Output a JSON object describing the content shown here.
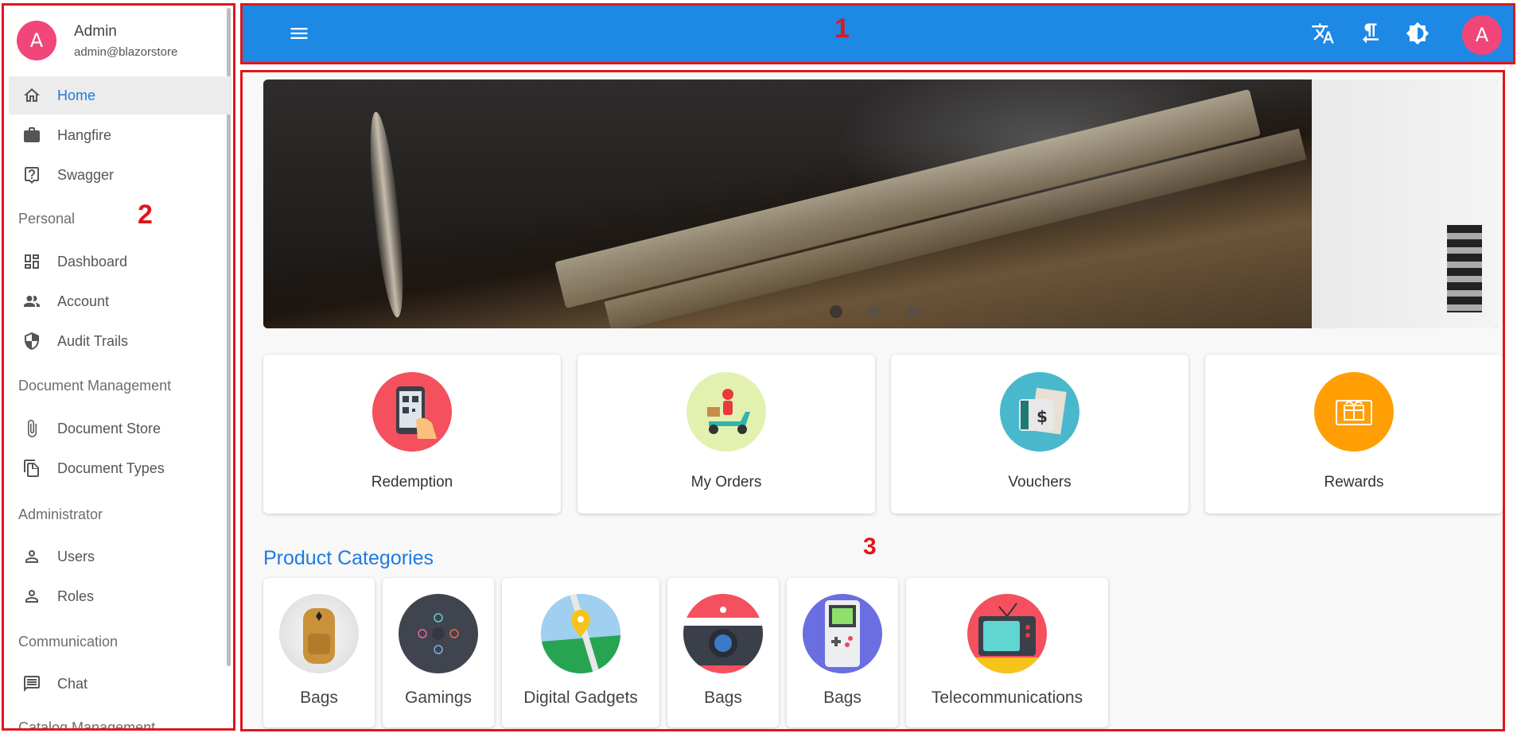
{
  "user": {
    "avatar_letter": "A",
    "name": "Admin",
    "email": "admin@blazorstore"
  },
  "nav": {
    "home": "Home",
    "hangfire": "Hangfire",
    "swagger": "Swagger",
    "section_personal": "Personal",
    "dashboard": "Dashboard",
    "account": "Account",
    "audit_trails": "Audit Trails",
    "section_document": "Document Management",
    "document_store": "Document Store",
    "document_types": "Document Types",
    "section_admin": "Administrator",
    "users": "Users",
    "roles": "Roles",
    "section_communication": "Communication",
    "chat": "Chat",
    "section_catalog": "Catalog Management"
  },
  "topbar": {
    "avatar_letter": "A"
  },
  "annotations": {
    "one": "1",
    "two": "2",
    "three": "3"
  },
  "quick_links": [
    {
      "label": "Redemption",
      "color": "#f4505e"
    },
    {
      "label": "My Orders",
      "color": "#e3f1b0"
    },
    {
      "label": "Vouchers",
      "color": "#4ab8cc"
    },
    {
      "label": "Rewards",
      "color": "#ff9f05"
    }
  ],
  "product_categories": {
    "title": "Product Categories",
    "items": [
      {
        "label": "Bags"
      },
      {
        "label": "Gamings"
      },
      {
        "label": "Digital Gadgets"
      },
      {
        "label": "Bags"
      },
      {
        "label": "Bags"
      },
      {
        "label": "Telecommunications"
      }
    ]
  },
  "carousel": {
    "slide_count": 3,
    "active_index": 0
  },
  "colors": {
    "primary": "#1e88e5",
    "avatar": "#f0467a",
    "accent_text": "#1e7be0",
    "annotation": "#e0161d"
  }
}
